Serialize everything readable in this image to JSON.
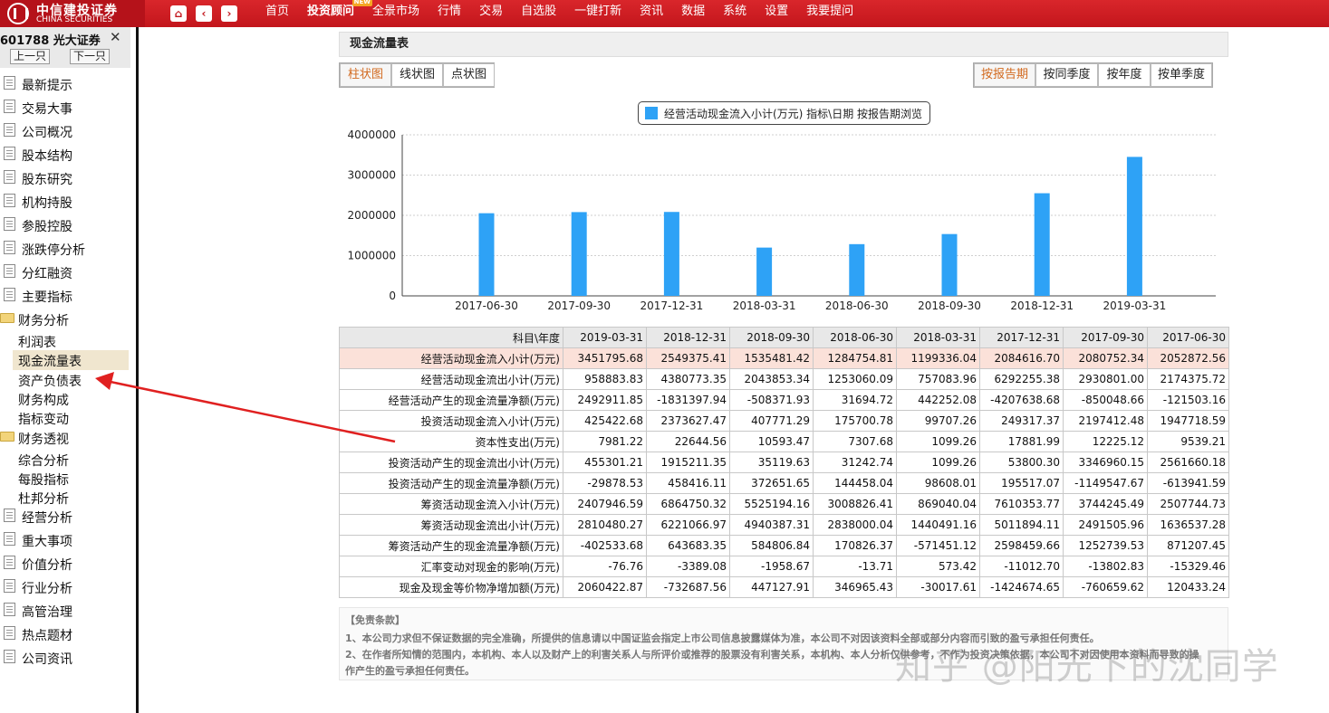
{
  "app": {
    "logo_cn": "中信建投证券",
    "logo_en": "CHINA SECURITIES",
    "accent": "#c3161c"
  },
  "toolbar": {
    "icons": [
      "home-icon",
      "back-icon",
      "forward-icon"
    ],
    "nav": [
      {
        "label": "首页"
      },
      {
        "label": "投资顾问",
        "badge": "NEW"
      },
      {
        "label": "全景市场"
      },
      {
        "label": "行情"
      },
      {
        "label": "交易"
      },
      {
        "label": "自选股"
      },
      {
        "label": "一键打新"
      },
      {
        "label": "资讯"
      },
      {
        "label": "数据"
      },
      {
        "label": "系统"
      },
      {
        "label": "设置"
      },
      {
        "label": "我要提问"
      }
    ]
  },
  "sidebar": {
    "stock_title": "601788 光大证券",
    "close_glyph": "✕",
    "prev_label": "上一只",
    "next_label": "下一只",
    "items": [
      {
        "label": "最新提示",
        "kind": "doc"
      },
      {
        "label": "交易大事",
        "kind": "doc"
      },
      {
        "label": "公司概况",
        "kind": "doc"
      },
      {
        "label": "股本结构",
        "kind": "doc"
      },
      {
        "label": "股东研究",
        "kind": "doc"
      },
      {
        "label": "机构持股",
        "kind": "doc"
      },
      {
        "label": "参股控股",
        "kind": "doc"
      },
      {
        "label": "涨跌停分析",
        "kind": "doc"
      },
      {
        "label": "分红融资",
        "kind": "doc"
      },
      {
        "label": "主要指标",
        "kind": "doc"
      },
      {
        "label": "财务分析",
        "kind": "folder"
      },
      {
        "label": "利润表",
        "kind": "sub"
      },
      {
        "label": "现金流量表",
        "kind": "sub",
        "selected": true
      },
      {
        "label": "资产负债表",
        "kind": "sub"
      },
      {
        "label": "财务构成",
        "kind": "sub"
      },
      {
        "label": "指标变动",
        "kind": "sub"
      },
      {
        "label": "财务透视",
        "kind": "folder"
      },
      {
        "label": "综合分析",
        "kind": "sub"
      },
      {
        "label": "每股指标",
        "kind": "sub"
      },
      {
        "label": "杜邦分析",
        "kind": "sub"
      },
      {
        "label": "经营分析",
        "kind": "doc"
      },
      {
        "label": "重大事项",
        "kind": "doc"
      },
      {
        "label": "价值分析",
        "kind": "doc"
      },
      {
        "label": "行业分析",
        "kind": "doc"
      },
      {
        "label": "高管治理",
        "kind": "doc"
      },
      {
        "label": "热点题材",
        "kind": "doc"
      },
      {
        "label": "公司资讯",
        "kind": "doc"
      }
    ]
  },
  "main": {
    "title": "现金流量表",
    "chart_tabs": [
      "柱状图",
      "线状图",
      "点状图"
    ],
    "period_tabs": [
      "按报告期",
      "按同季度",
      "按年度",
      "按单季度"
    ],
    "active_chart_tab": 0,
    "active_period_tab": 0
  },
  "chart_data": {
    "type": "bar",
    "legend": "经营活动现金流入小计(万元) 指标\\日期 按报告期浏览",
    "categories": [
      "2017-06-30",
      "2017-09-30",
      "2017-12-31",
      "2018-03-31",
      "2018-06-30",
      "2018-09-30",
      "2018-12-31",
      "2019-03-31"
    ],
    "values": [
      2052872.56,
      2080752.34,
      2084616.7,
      1199336.04,
      1284754.81,
      1535481.42,
      2549375.41,
      3451795.68
    ],
    "y_ticks": [
      "4000000",
      "3000000",
      "2000000",
      "1000000",
      "0"
    ],
    "ylim": [
      0,
      4000000
    ],
    "bar_color": "#2ea2f6",
    "grid": "dashed horizontal"
  },
  "table": {
    "header": [
      "科目\\年度",
      "2019-03-31",
      "2018-12-31",
      "2018-09-30",
      "2018-06-30",
      "2018-03-31",
      "2017-12-31",
      "2017-09-30",
      "2017-06-30"
    ],
    "rows": [
      [
        "经营活动现金流入小计(万元)",
        "3451795.68",
        "2549375.41",
        "1535481.42",
        "1284754.81",
        "1199336.04",
        "2084616.70",
        "2080752.34",
        "2052872.56"
      ],
      [
        "经营活动现金流出小计(万元)",
        "958883.83",
        "4380773.35",
        "2043853.34",
        "1253060.09",
        "757083.96",
        "6292255.38",
        "2930801.00",
        "2174375.72"
      ],
      [
        "经营活动产生的现金流量净额(万元)",
        "2492911.85",
        "-1831397.94",
        "-508371.93",
        "31694.72",
        "442252.08",
        "-4207638.68",
        "-850048.66",
        "-121503.16"
      ],
      [
        "投资活动现金流入小计(万元)",
        "425422.68",
        "2373627.47",
        "407771.29",
        "175700.78",
        "99707.26",
        "249317.37",
        "2197412.48",
        "1947718.59"
      ],
      [
        "资本性支出(万元)",
        "7981.22",
        "22644.56",
        "10593.47",
        "7307.68",
        "1099.26",
        "17881.99",
        "12225.12",
        "9539.21"
      ],
      [
        "投资活动产生的现金流出小计(万元)",
        "455301.21",
        "1915211.35",
        "35119.63",
        "31242.74",
        "1099.26",
        "53800.30",
        "3346960.15",
        "2561660.18"
      ],
      [
        "投资活动产生的现金流量净额(万元)",
        "-29878.53",
        "458416.11",
        "372651.65",
        "144458.04",
        "98608.01",
        "195517.07",
        "-1149547.67",
        "-613941.59"
      ],
      [
        "筹资活动现金流入小计(万元)",
        "2407946.59",
        "6864750.32",
        "5525194.16",
        "3008826.41",
        "869040.04",
        "7610353.77",
        "3744245.49",
        "2507744.73"
      ],
      [
        "筹资活动现金流出小计(万元)",
        "2810480.27",
        "6221066.97",
        "4940387.31",
        "2838000.04",
        "1440491.16",
        "5011894.11",
        "2491505.96",
        "1636537.28"
      ],
      [
        "筹资活动产生的现金流量净额(万元)",
        "-402533.68",
        "643683.35",
        "584806.84",
        "170826.37",
        "-571451.12",
        "2598459.66",
        "1252739.53",
        "871207.45"
      ],
      [
        "汇率变动对现金的影响(万元)",
        "-76.76",
        "-3389.08",
        "-1958.67",
        "-13.71",
        "573.42",
        "-11012.70",
        "-13802.83",
        "-15329.46"
      ],
      [
        "现金及现金等价物净增加额(万元)",
        "2060422.87",
        "-732687.56",
        "447127.91",
        "346965.43",
        "-30017.61",
        "-1424674.65",
        "-760659.62",
        "120433.24"
      ]
    ],
    "highlight_row": 0
  },
  "disclaimer": {
    "title": "【免责条款】",
    "line1": "1、本公司力求但不保证数据的完全准确，所提供的信息请以中国证监会指定上市公司信息披露媒体为准，本公司不对因该资料全部或部分内容而引致的盈亏承担任何责任。",
    "line2": "2、在作者所知情的范围内，本机构、本人以及财产上的利害关系人与所评价或推荐的股票没有利害关系，本机构、本人分析仅供参考，不作为投资决策依据，本公司不对因使用本资料而导致的操",
    "line3": "作产生的盈亏承担任何责任。"
  },
  "watermark": "知乎 @阳光下的沈同学"
}
